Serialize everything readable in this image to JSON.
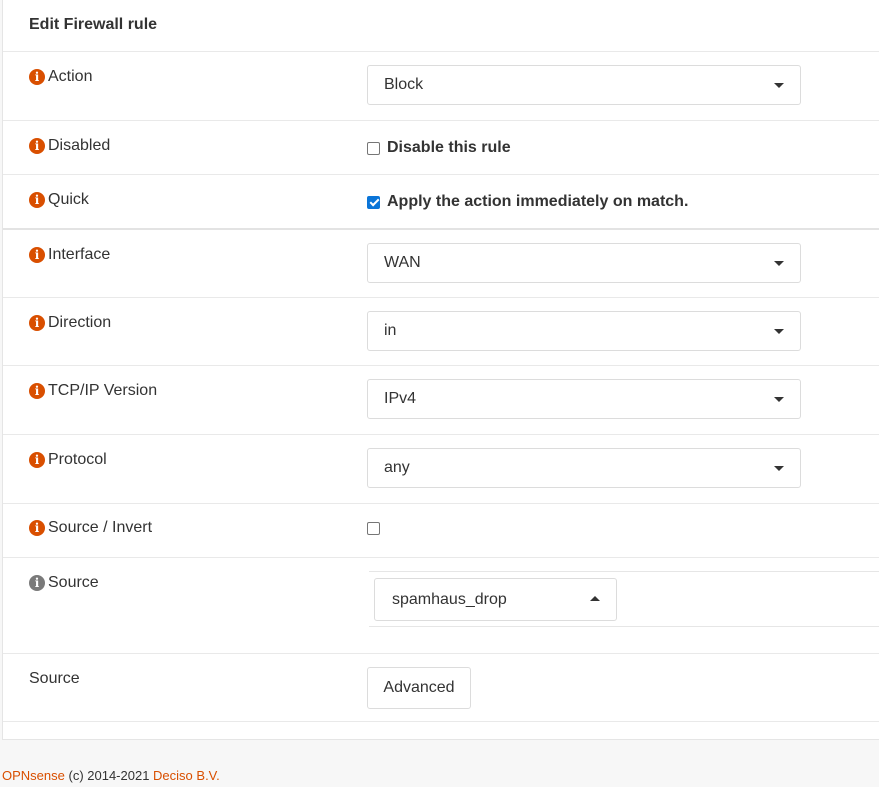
{
  "panel": {
    "title": "Edit Firewall rule"
  },
  "fields": {
    "action": {
      "label": "Action",
      "value": "Block"
    },
    "disabled": {
      "label": "Disabled",
      "checkbox_label": "Disable this rule",
      "checked": false
    },
    "quick": {
      "label": "Quick",
      "checkbox_label": "Apply the action immediately on match.",
      "checked": true
    },
    "interface": {
      "label": "Interface",
      "value": "WAN"
    },
    "direction": {
      "label": "Direction",
      "value": "in"
    },
    "ip_version": {
      "label": "TCP/IP Version",
      "value": "IPv4"
    },
    "protocol": {
      "label": "Protocol",
      "value": "any"
    },
    "source_invert": {
      "label": "Source / Invert",
      "checked": false
    },
    "source": {
      "label": "Source",
      "value": "spamhaus_drop"
    },
    "source_advanced": {
      "label": "Source",
      "button_label": "Advanced"
    }
  },
  "footer": {
    "product": "OPNsense",
    "copyright": " (c) 2014-2021 ",
    "company": "Deciso B.V."
  },
  "colors": {
    "accent": "#d94f00",
    "checkbox_checked": "#0a75d8",
    "info_icon_gray": "#7a7a7a"
  }
}
